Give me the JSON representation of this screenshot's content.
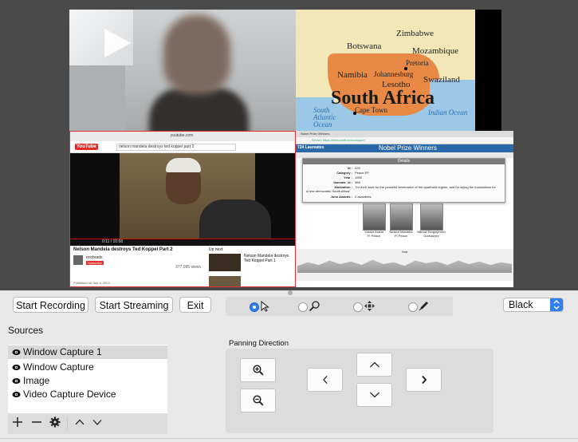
{
  "preview": {
    "map": {
      "countries": [
        "Zimbabwe",
        "Botswana",
        "Mozambique",
        "Namibia",
        "Pretoria",
        "Johannesburg",
        "Swaziland",
        "Lesotho",
        "Cape Town"
      ],
      "title": "South Africa",
      "ocean_left": "South Atlantic Ocean",
      "ocean_right": "Indian Ocean"
    },
    "youtube": {
      "url": "youtube.com",
      "logo": "YouTube",
      "search": "nelson mandela destroys ted koppel part 2",
      "time": "0:11 / 10:58",
      "title": "Nelson Mandela destroys Ted Koppel Part 2",
      "channel": "ericbrads",
      "subscribe": "Subscribe",
      "views": "377,095 views",
      "published": "Published on Sep 4, 2013",
      "up_next": "Up next",
      "side_title": "Nelson Mandela destroys Ted Koppel Part 1"
    },
    "nobel": {
      "tab": "Nobel Prize Winners",
      "address": "Secure  https://beta.wolfr.io/developer/",
      "header_left": "724 Laureates",
      "header_title": "Nobel Prize Winners",
      "card_title": "Details",
      "rows": [
        {
          "k": "Id :",
          "v": "225"
        },
        {
          "k": "Category :",
          "v": "Peace EP"
        },
        {
          "k": "Year :",
          "v": "1993"
        },
        {
          "k": "laureate_id :",
          "v": "368"
        },
        {
          "k": "Motivation :",
          "v": "\"for their work for the peaceful termination of the apartheid regime, and for laying the foundations for a new democratic South Africa\""
        },
        {
          "k": "John Awards :",
          "v": "2 awardees"
        }
      ],
      "people": [
        {
          "name": "Yasser Arafat",
          "sub": "FI Peace"
        },
        {
          "name": "Nelson Mandela",
          "sub": "FI Peace"
        },
        {
          "name": "Mikhail Sergeyevich Gorbachev",
          "sub": ""
        }
      ],
      "timeline_label": "Year"
    }
  },
  "controls": {
    "start_recording": "Start Recording",
    "start_streaming": "Start Streaming",
    "exit": "Exit",
    "color_select": "Black"
  },
  "sources": {
    "title": "Sources",
    "items": [
      {
        "label": "Window Capture 1",
        "selected": true
      },
      {
        "label": "Window Capture",
        "selected": false
      },
      {
        "label": "Image",
        "selected": false
      },
      {
        "label": "Video Capture Device",
        "selected": false
      }
    ]
  },
  "panning": {
    "title": "Panning Direction"
  },
  "colors": {
    "accent": "#2f7fee",
    "panel": "#dcdcdc",
    "preview_bg": "#4a4a4a"
  }
}
